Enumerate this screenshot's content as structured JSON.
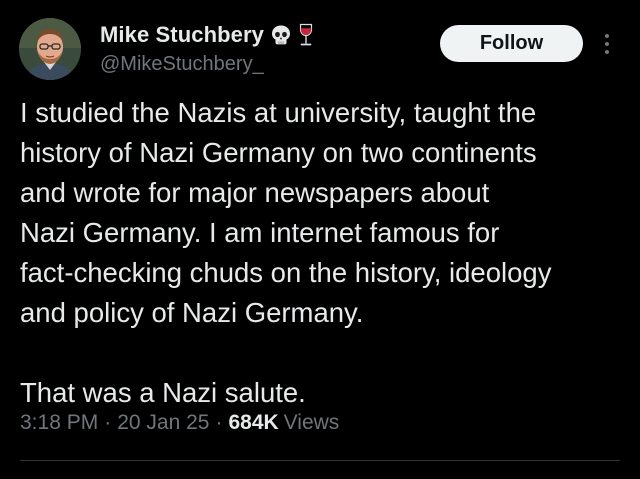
{
  "author": {
    "display_name": "Mike Stuchbery",
    "handle": "@MikeStuchbery_",
    "name_emojis": [
      "skull-icon",
      "wine-glass-icon"
    ]
  },
  "actions": {
    "follow_label": "Follow",
    "more_icon": "more-vertical-icon"
  },
  "tweet": {
    "paragraph_1": "I studied the Nazis at university, taught the\nhistory of Nazi Germany on two continents\nand wrote for major newspapers about\nNazi Germany. I am internet famous for\nfact-checking chuds on the history, ideology\nand policy of Nazi Germany.",
    "paragraph_2": "That was a Nazi salute."
  },
  "meta": {
    "time": "3:18 PM",
    "separator": "·",
    "date": "20 Jan 25",
    "views_count": "684K",
    "views_label": "Views"
  },
  "colors": {
    "background": "#000000",
    "primary_text": "#e7e9ea",
    "secondary_text": "#71767b",
    "follow_bg": "#eff3f4",
    "follow_text": "#0f1419"
  }
}
